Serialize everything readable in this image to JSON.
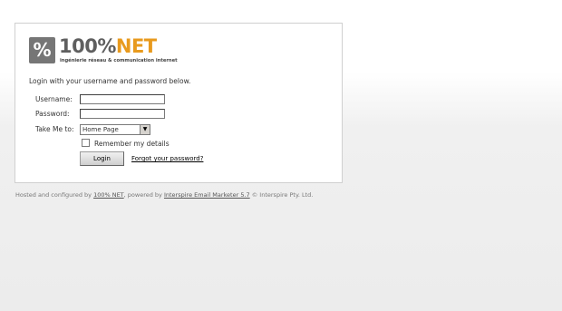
{
  "brand": {
    "logo_symbol": "%",
    "logo_number": "100%",
    "logo_net": "NET",
    "tagline": "ingénierie réseau & communication internet",
    "colors": {
      "grey": "#5f5f5f",
      "orange": "#e89a1d"
    }
  },
  "login": {
    "intro": "Login with your username and password below.",
    "username_label": "Username:",
    "username_value": "",
    "password_label": "Password:",
    "password_value": "",
    "takeme_label": "Take Me to:",
    "takeme_selected": "Home Page",
    "remember_label": "Remember my details",
    "remember_checked": false,
    "login_button": "Login",
    "forgot_link": "Forgot your password?"
  },
  "footer": {
    "prefix": "Hosted and configured by ",
    "host_link": "100% NET",
    "mid": ", powered by ",
    "product_link": "Interspire Email Marketer 5.7",
    "suffix": " © Interspire Pty. Ltd."
  }
}
